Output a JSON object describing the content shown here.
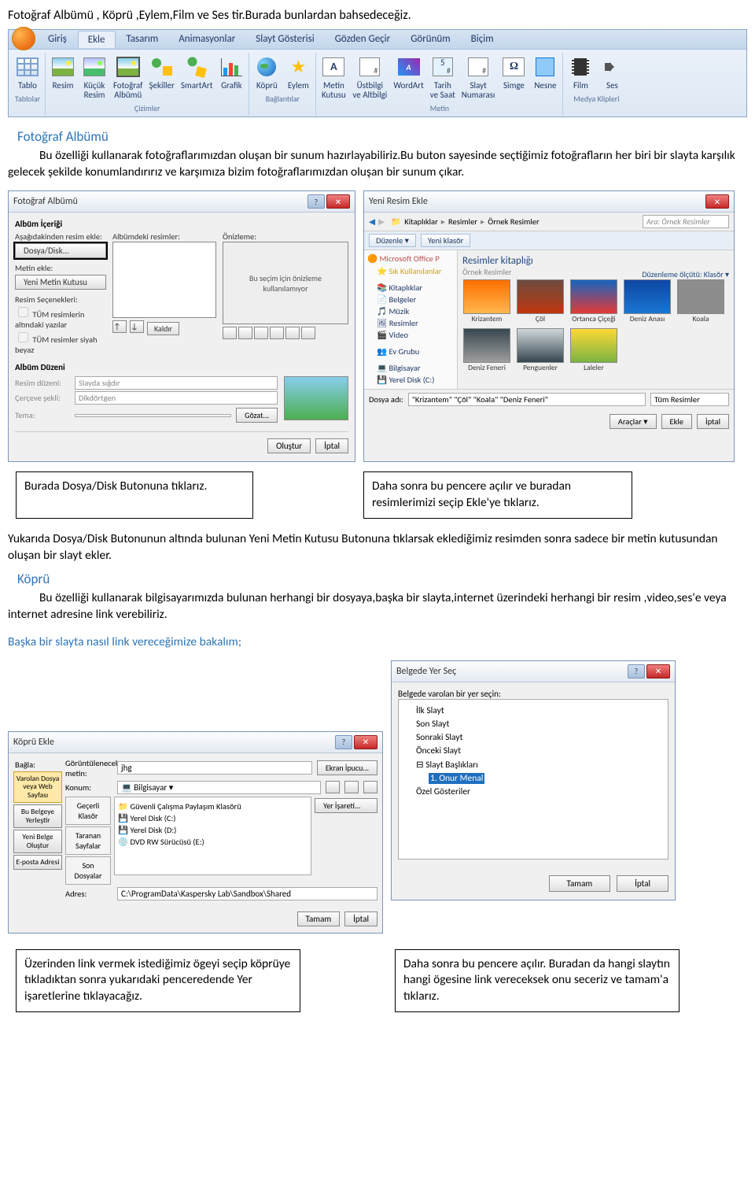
{
  "intro": "Fotoğraf Albümü , Köprü ,Eylem,Film ve Ses tir.Burada bunlardan bahsedeceğiz.",
  "ribbon": {
    "tabs": [
      "Giriş",
      "Ekle",
      "Tasarım",
      "Animasyonlar",
      "Slayt Gösterisi",
      "Gözden Geçir",
      "Görünüm",
      "Biçim"
    ],
    "groups": {
      "tablolar": {
        "label": "Tablolar",
        "items": [
          {
            "l": "Tablo"
          }
        ]
      },
      "cizimler": {
        "label": "Çizimler",
        "items": [
          {
            "l": "Resim"
          },
          {
            "l": "Küçük\nResim"
          },
          {
            "l": "Fotoğraf\nAlbümü"
          },
          {
            "l": "Şekiller"
          },
          {
            "l": "SmartArt"
          },
          {
            "l": "Grafik"
          }
        ]
      },
      "baglantilar": {
        "label": "Bağlantılar",
        "items": [
          {
            "l": "Köprü"
          },
          {
            "l": "Eylem"
          }
        ]
      },
      "metin": {
        "label": "Metin",
        "items": [
          {
            "l": "Metin\nKutusu"
          },
          {
            "l": "Üstbilgi\nve Altbilgi"
          },
          {
            "l": "WordArt"
          },
          {
            "l": "Tarih\nve Saat"
          },
          {
            "l": "Slayt\nNumarası"
          },
          {
            "l": "Simge"
          },
          {
            "l": "Nesne"
          }
        ]
      },
      "medya": {
        "label": "Medya Klipleri",
        "items": [
          {
            "l": "Film"
          },
          {
            "l": "Ses"
          }
        ]
      }
    }
  },
  "section_album": {
    "title": "Fotoğraf Albümü",
    "p1": "Bu özelliği kullanarak fotoğraflarımızdan oluşan bir sunum hazırlayabiliriz.Bu buton sayesinde seçtiğimiz fotoğrafların her biri bir slayta karşılık gelecek şekilde konumlandırırız ve karşımıza bizim fotoğraflarımızdan oluşan bir sunum çıkar."
  },
  "photo_album_dialog": {
    "title": "Fotoğraf Albümü",
    "content_label": "Albüm İçeriği",
    "insert_from": "Aşağıdakinden resim ekle:",
    "dosya_disk": "Dosya/Disk...",
    "metin_ekle": "Metin ekle:",
    "yeni_metin": "Yeni Metin Kutusu",
    "opts_label": "Resim Seçenekleri:",
    "opt1": "TÜM resimlerin altındaki yazılar",
    "opt2": "TÜM resimler siyah beyaz",
    "list_label": "Albümdeki resimler:",
    "preview_label": "Önizleme:",
    "preview_text": "Bu seçim için önizleme kullanılamıyor",
    "remove": "Kaldır",
    "layout_label": "Albüm Düzeni",
    "resim_duzeni": "Resim düzeni:",
    "resim_duzeni_v": "Slayda sığdır",
    "cerceve": "Çerçeve şekli:",
    "cerceve_v": "Dikdörtgen",
    "tema": "Tema:",
    "gozat": "Gözat...",
    "olustur": "Oluştur",
    "iptal": "İptal"
  },
  "explorer_dialog": {
    "title": "Yeni Resim Ekle",
    "crumb": [
      "Kitaplıklar",
      "Resimler",
      "Örnek Resimler"
    ],
    "search_ph": "Ara: Örnek Resimler",
    "tools": [
      "Düzenle ▾",
      "Yeni klasör"
    ],
    "view_tools": "Düzenleme ölçütü:   Klasör ▾",
    "side_hdr": "Microsoft Office P",
    "fav": "Sık Kullanılanlar",
    "side_items": [
      "Kitaplıklar",
      "Belgeler",
      "Müzik",
      "Resimler",
      "Video"
    ],
    "side_items2": [
      "Ev Grubu"
    ],
    "side_items3": [
      "Bilgisayar",
      "Yerel Disk (C:)"
    ],
    "lib_title": "Resimler kitaplığı",
    "lib_sub": "Örnek Resimler",
    "thumbs": [
      "Krizantem",
      "Çöl",
      "Ortanca Çiçeği",
      "Deniz Anası",
      "Koala",
      "Deniz Feneri",
      "Penguenler",
      "Laleler"
    ],
    "file_label": "Dosya adı:",
    "file_value": "\"Krizantem\" \"Çöl\" \"Koala\" \"Deniz Feneri\"",
    "filter": "Tüm Resimler",
    "araclar": "Araçlar ▾",
    "ekle": "Ekle",
    "iptal": "İptal"
  },
  "caption_row1": {
    "left": "Burada Dosya/Disk Butonuna tıklarız.",
    "right": "Daha sonra bu pencere açılır ve buradan resimlerimizi seçip Ekle'ye tıklarız."
  },
  "para_after_row1": "Yukarıda Dosya/Disk Butonunun altında bulunan Yeni Metin Kutusu Butonuna tıklarsak eklediğimiz resimden sonra sadece bir metin kutusundan oluşan bir slayt ekler.",
  "section_link": {
    "title": "Köprü",
    "p": "Bu özelliği kullanarak bilgisayarımızda bulunan herhangi bir dosyaya,başka bir slayta,internet üzerindeki herhangi bir resim ,video,ses'e veya internet adresine  link verebiliriz."
  },
  "link_howto": "Başka bir slayta nasıl link vereceğimize bakalım;",
  "hyper_dialog": {
    "title": "Köprü Ekle",
    "bagla": "Bağla:",
    "goruntu": "Görüntülenecek metin:",
    "goruntu_v": "jhg",
    "ekran_ipucu": "Ekran İpucu...",
    "side": [
      {
        "l": "Varolan Dosya\nveya Web\nSayfası",
        "sel": true
      },
      {
        "l": "Bu Belgeye\nYerleştir"
      },
      {
        "l": "Yeni Belge\nOluştur"
      },
      {
        "l": "E-posta Adresi"
      }
    ],
    "konum": "Konum:",
    "konum_v": "Bilgisayar",
    "nav": [
      "Geçerli\nKlasör",
      "Taranan\nSayfalar",
      "Son\nDosyalar"
    ],
    "list": [
      "Güvenli Çalışma Paylaşım Klasörü",
      "Yerel Disk (C:)",
      "Yerel Disk (D:)",
      "DVD RW Sürücüsü (E:)"
    ],
    "yer_isareti": "Yer İşareti...",
    "adres": "Adres:",
    "adres_v": "C:\\ProgramData\\Kaspersky Lab\\Sandbox\\Shared",
    "tamam": "Tamam",
    "iptal": "İptal"
  },
  "place_dialog": {
    "title": "Belgede Yer Seç",
    "label": "Belgede varolan bir yer seçin:",
    "tree": {
      "items": [
        "İlk Slayt",
        "Son Slayt",
        "Sonraki Slayt",
        "Önceki Slayt"
      ],
      "group": "Slayt Başlıkları",
      "selected": "1. Onur Menal",
      "after": "Özel Gösteriler"
    },
    "tamam": "Tamam",
    "iptal": "İptal"
  },
  "caption_row2": {
    "left": "Üzerinden link vermek istediğimiz ögeyi seçip köprüye tıkladıktan sonra yukarıdaki penceredende Yer işaretlerine tıklayacağız.",
    "right": "Daha sonra bu pencere açılır. Buradan da hangi slaytın hangi ögesine link vereceksek onu seceriz ve tamam'a tıklarız."
  }
}
